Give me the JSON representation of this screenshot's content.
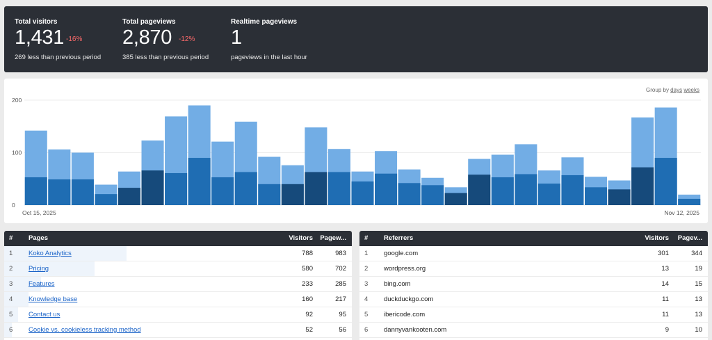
{
  "totals": {
    "visitors": {
      "label": "Total visitors",
      "value": "1,431",
      "change": "-16%",
      "sub": "269 less than previous period"
    },
    "pageviews": {
      "label": "Total pageviews",
      "value": "2,870",
      "change": "-12%",
      "sub": "385 less than previous period"
    },
    "realtime": {
      "label": "Realtime pageviews",
      "value": "1",
      "sub": "pageviews in the last hour"
    }
  },
  "chart_controls": {
    "group_by_label": "Group by",
    "days": "days",
    "weeks": "weeks"
  },
  "chart_data": {
    "type": "bar",
    "ylim": [
      0,
      200
    ],
    "y_ticks": [
      "200",
      "100",
      "0"
    ],
    "x_start_label": "Oct 15, 2025",
    "x_end_label": "Nov 12, 2025",
    "series": [
      {
        "name": "Pageviews",
        "color": "#72ade5",
        "values": [
          142,
          106,
          100,
          39,
          64,
          123,
          169,
          190,
          121,
          159,
          92,
          76,
          148,
          107,
          64,
          103,
          68,
          52,
          34,
          88,
          96,
          116,
          66,
          91,
          54,
          47,
          167,
          186,
          20
        ]
      },
      {
        "name": "Visitors",
        "color": "#1f6db3",
        "values": [
          53,
          49,
          49,
          21,
          33,
          66,
          61,
          90,
          53,
          63,
          40,
          40,
          63,
          63,
          45,
          60,
          42,
          38,
          23,
          58,
          53,
          59,
          41,
          57,
          34,
          30,
          72,
          90,
          12
        ]
      }
    ],
    "dark_blue_color": "#164a7b",
    "weekend_indices": [
      4,
      5,
      11,
      12,
      18,
      19,
      25,
      26
    ]
  },
  "pages_table": {
    "headers": {
      "rank": "#",
      "name": "Pages",
      "visitors": "Visitors",
      "pageviews": "Pagew..."
    },
    "rows": [
      {
        "rank": "1",
        "name": "Koko Analytics",
        "visitors": "788",
        "pageviews": "983",
        "share": 0.8
      },
      {
        "rank": "2",
        "name": "Pricing",
        "visitors": "580",
        "pageviews": "702",
        "share": 0.59
      },
      {
        "rank": "3",
        "name": "Features",
        "visitors": "233",
        "pageviews": "285",
        "share": 0.24
      },
      {
        "rank": "4",
        "name": "Knowledge base",
        "visitors": "160",
        "pageviews": "217",
        "share": 0.16
      },
      {
        "rank": "5",
        "name": "Contact us",
        "visitors": "92",
        "pageviews": "95",
        "share": 0.09
      },
      {
        "rank": "6",
        "name": "Cookie vs. cookieless tracking method",
        "visitors": "52",
        "pageviews": "56",
        "share": 0.05
      }
    ]
  },
  "referrers_table": {
    "headers": {
      "rank": "#",
      "name": "Referrers",
      "visitors": "Visitors",
      "pageviews": "Pagev..."
    },
    "rows": [
      {
        "rank": "1",
        "name": "google.com",
        "visitors": "301",
        "pageviews": "344"
      },
      {
        "rank": "2",
        "name": "wordpress.org",
        "visitors": "13",
        "pageviews": "19"
      },
      {
        "rank": "3",
        "name": "bing.com",
        "visitors": "14",
        "pageviews": "15"
      },
      {
        "rank": "4",
        "name": "duckduckgo.com",
        "visitors": "11",
        "pageviews": "13"
      },
      {
        "rank": "5",
        "name": "ibericode.com",
        "visitors": "11",
        "pageviews": "13"
      },
      {
        "rank": "6",
        "name": "dannyvankooten.com",
        "visitors": "9",
        "pageviews": "10"
      }
    ]
  }
}
